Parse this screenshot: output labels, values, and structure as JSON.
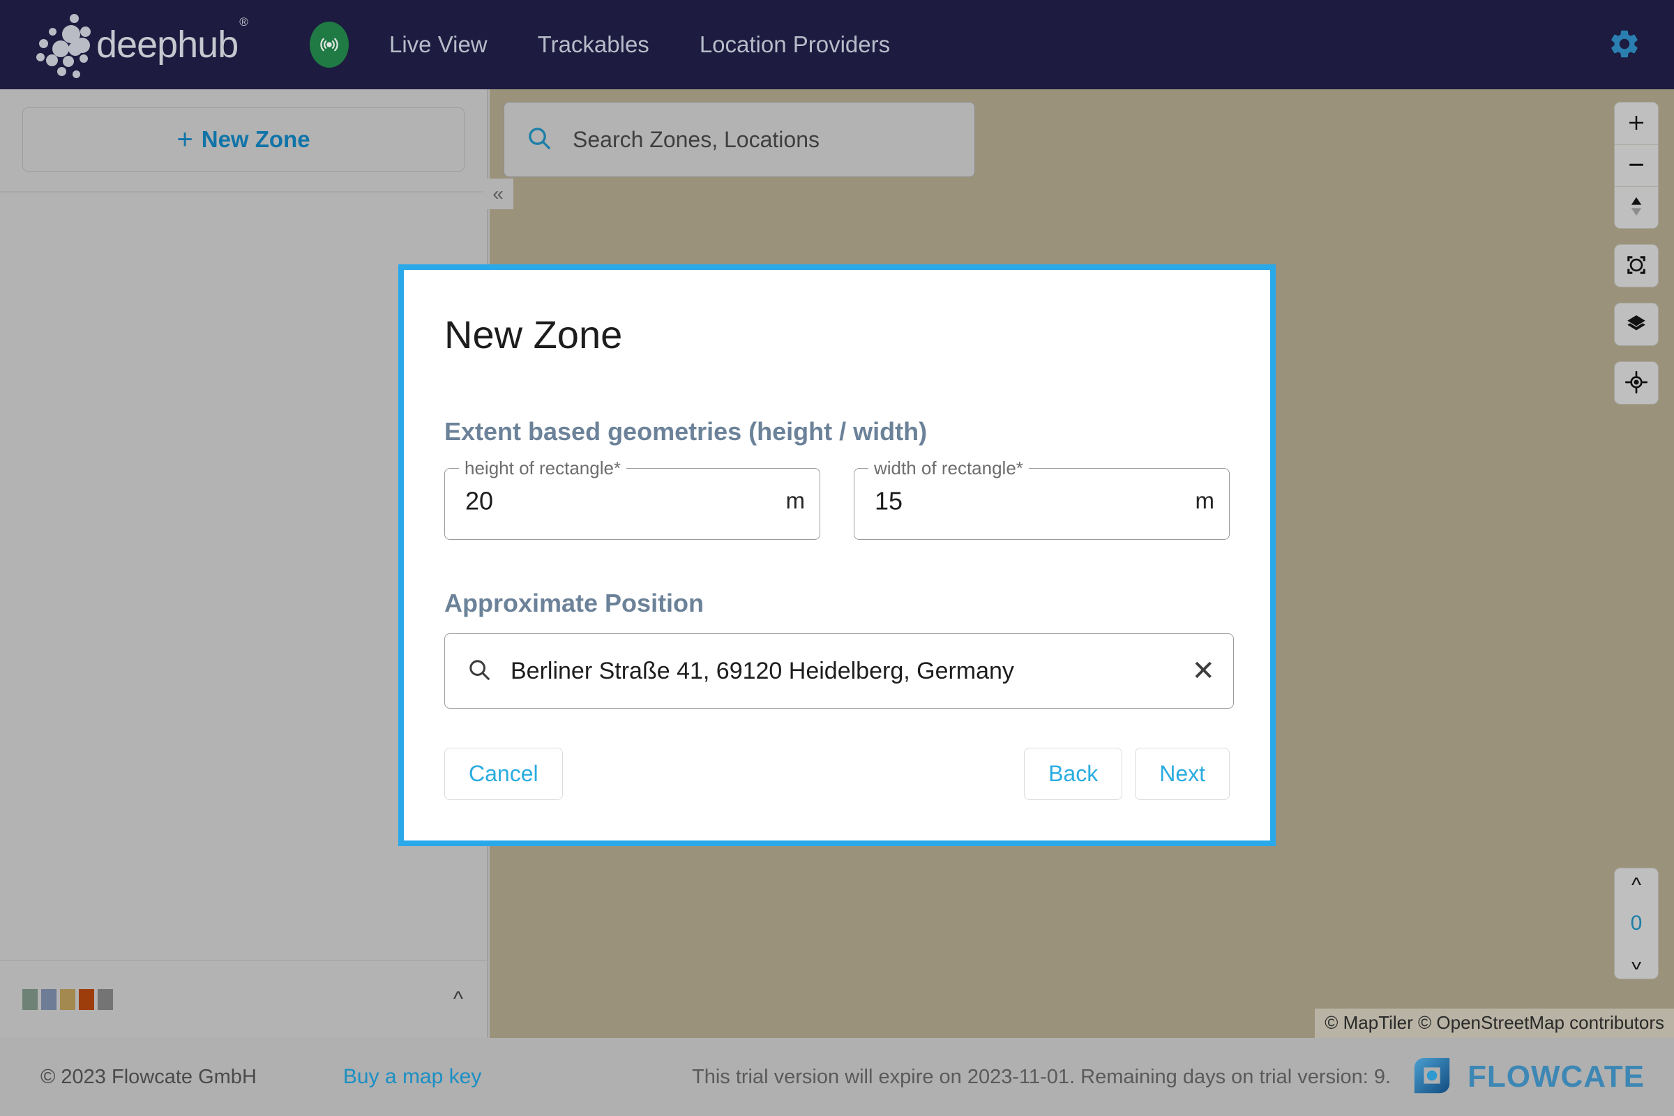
{
  "topbar": {
    "brand_name": "deephub",
    "brand_mark": "registered-trademark",
    "live_icon": "broadcast-icon",
    "nav": [
      {
        "label": "Live View"
      },
      {
        "label": "Trackables"
      },
      {
        "label": "Location Providers"
      }
    ],
    "settings_icon": "gear-icon",
    "colors": {
      "background": "#1d1b3f",
      "brand_text": "#c5c8cf",
      "nav_text": "#b6bcc9",
      "live_badge": "#1f7a44",
      "gear": "#2a7fb0"
    }
  },
  "sidebar": {
    "new_zone_button": "New Zone",
    "new_zone_plus": "+",
    "legend_colors": [
      "#6e8276",
      "#6e7c96",
      "#a3894f",
      "#9d3d0c",
      "#747474"
    ],
    "collapse_up_icon": "chevron-up-icon"
  },
  "map": {
    "search_placeholder": "Search Zones, Locations",
    "search_icon": "search-icon",
    "collapse_icon": "double-chevron-left-icon",
    "controls": [
      {
        "name": "zoom-in",
        "icon": "plus-icon",
        "label": "+"
      },
      {
        "name": "zoom-out",
        "icon": "minus-icon",
        "label": "−"
      },
      {
        "name": "compass",
        "icon": "compass-icon",
        "label": ""
      },
      {
        "name": "fit-bounds",
        "icon": "fit-bounds-icon",
        "label": ""
      },
      {
        "name": "layers",
        "icon": "layers-icon",
        "label": ""
      },
      {
        "name": "locate",
        "icon": "locate-icon",
        "label": ""
      }
    ],
    "floor_selector": {
      "up_icon": "chevron-up-icon",
      "level": "0",
      "down_icon": "chevron-down-icon"
    },
    "attribution": "© MapTiler © OpenStreetMap contributors",
    "background_color": "#9b927c"
  },
  "dialog": {
    "title": "New Zone",
    "section_geometry": "Extent based geometries (height / width)",
    "fields": [
      {
        "label": "height of rectangle*",
        "value": "20",
        "unit": "m"
      },
      {
        "label": "width of rectangle*",
        "value": "15",
        "unit": "m"
      }
    ],
    "section_position": "Approximate Position",
    "address": {
      "search_icon": "search-icon",
      "value": "Berliner Straße 41, 69120 Heidelberg, Germany",
      "clear_icon": "close-icon",
      "clear_glyph": "✕"
    },
    "buttons": {
      "cancel": "Cancel",
      "back": "Back",
      "next": "Next"
    },
    "accent_color": "#29a8ea",
    "heading_color": "#6b8299"
  },
  "footer": {
    "copyright": "© 2023 Flowcate GmbH",
    "buy_link": "Buy a map key",
    "trial_notice": "This trial version will expire on 2023-11-01. Remaining days on trial version: 9.",
    "logo_text": "FLOWCATE",
    "logo_icon": "flowcate-logo-icon"
  }
}
